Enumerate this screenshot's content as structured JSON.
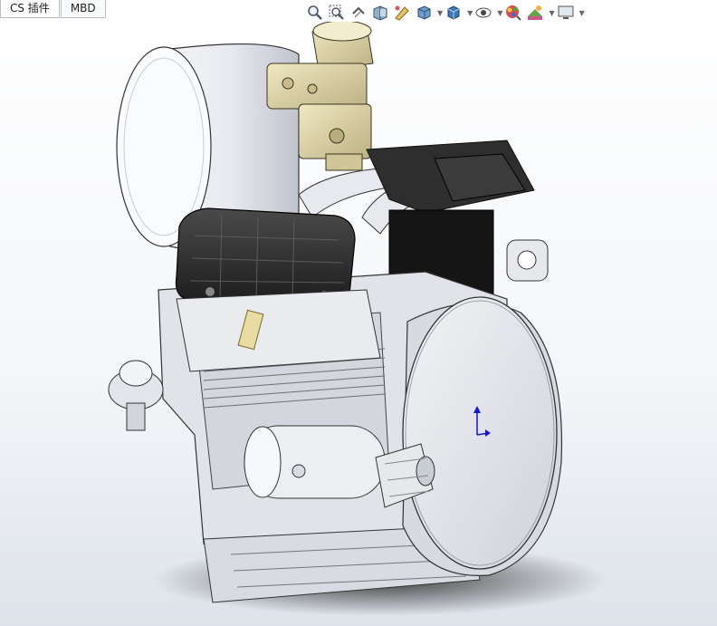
{
  "tabs": [
    {
      "label": "CS 插件"
    },
    {
      "label": "MBD"
    }
  ],
  "hud": {
    "icons": [
      "zoom-to-fit-icon",
      "zoom-to-area-icon",
      "previous-view-icon",
      "section-view-icon",
      "dynamic-annotation-icon",
      "view-orientation-icon",
      "display-style-icon",
      "hide-show-items-icon",
      "edit-appearance-icon",
      "apply-scene-icon",
      "view-settings-icon"
    ]
  },
  "model": {
    "name": "v-twin-engine-assembly"
  },
  "colors": {
    "background_top": "#ffffff",
    "background_bottom": "#dde3ea",
    "carb_tan": "#d9d0a2",
    "valve_cover": "#2b2b2b",
    "housing": "#e4e6ea",
    "triad_blue": "#1515d0"
  }
}
